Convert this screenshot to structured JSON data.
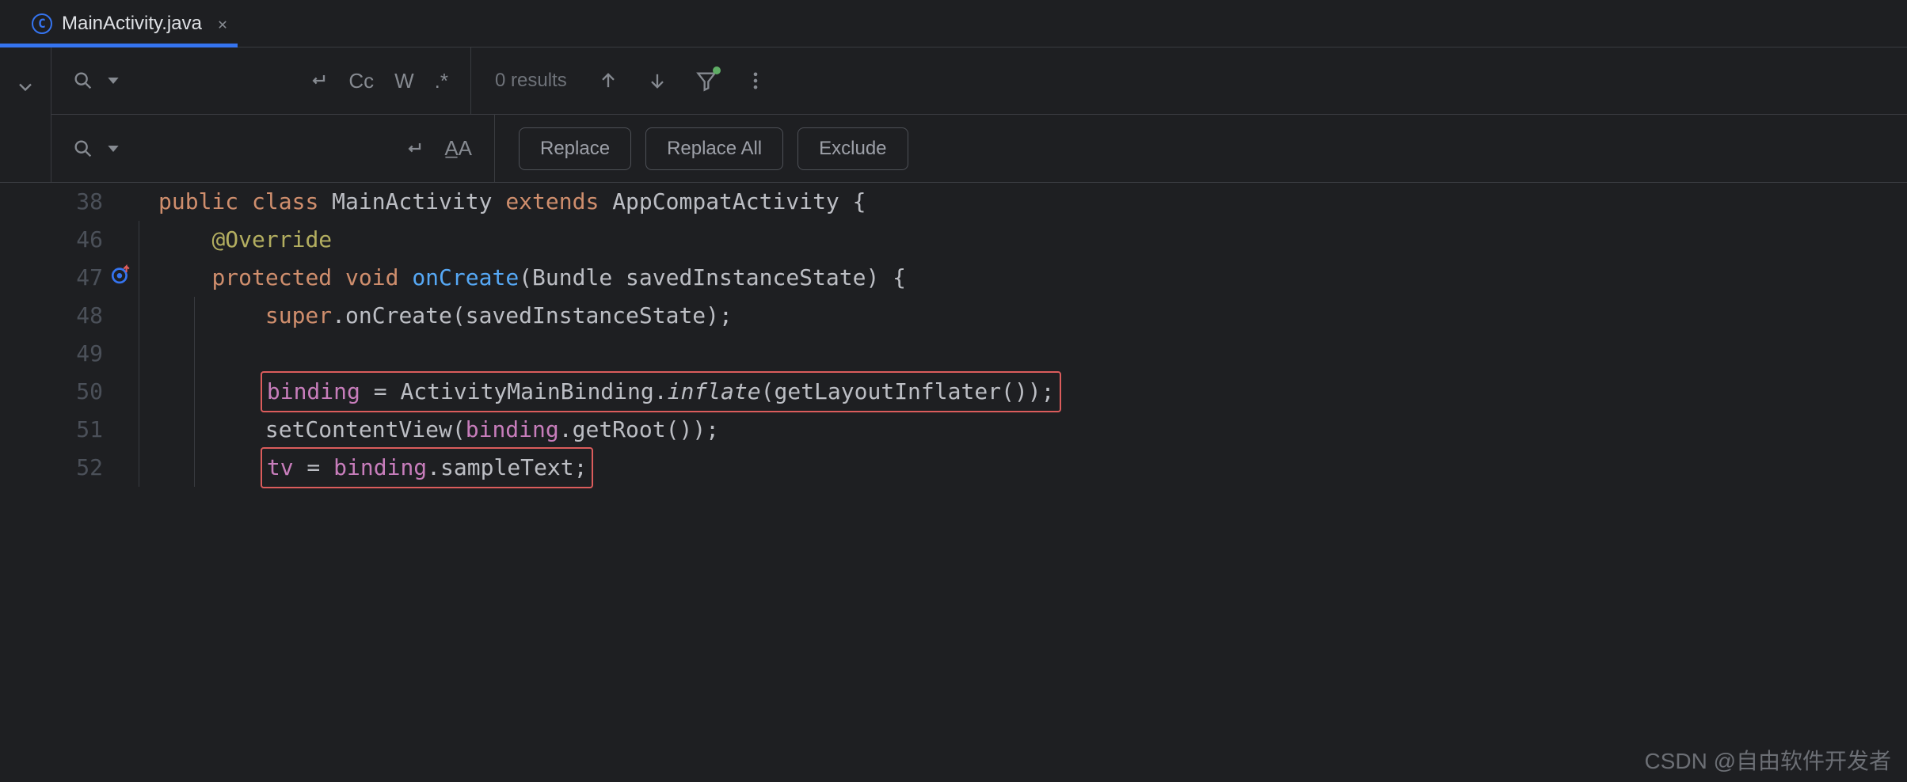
{
  "tab": {
    "filename": "MainActivity.java"
  },
  "search": {
    "results": "0 results",
    "cc": "Cc",
    "w": "W",
    "regex": ".*",
    "aa": "A̲A",
    "replace_btn": "Replace",
    "replace_all_btn": "Replace All",
    "exclude_btn": "Exclude"
  },
  "gutter": [
    "38",
    "46",
    "47",
    "48",
    "49",
    "50",
    "51",
    "52"
  ],
  "code": {
    "l38": {
      "public": "public",
      "class": "class",
      "name": " MainActivity ",
      "extends": "extends",
      "parent": " AppCompatActivity {"
    },
    "l46": {
      "ann": "@Override"
    },
    "l47": {
      "protected": "protected",
      "void": "void",
      "method": "onCreate",
      "params": "(Bundle savedInstanceState) {"
    },
    "l48": {
      "super": "super",
      "rest": ".onCreate(savedInstanceState);"
    },
    "l50": {
      "field": "binding",
      "eq": " = ActivityMainBinding.",
      "inflate": "inflate",
      "rest": "(getLayoutInflater());"
    },
    "l51": {
      "pre": "setContentView(",
      "field": "binding",
      "rest": ".getRoot());"
    },
    "l52": {
      "tv": "tv",
      "eq": " = ",
      "field": "binding",
      "rest": ".sampleText;"
    }
  },
  "watermark": "CSDN @自由软件开发者"
}
